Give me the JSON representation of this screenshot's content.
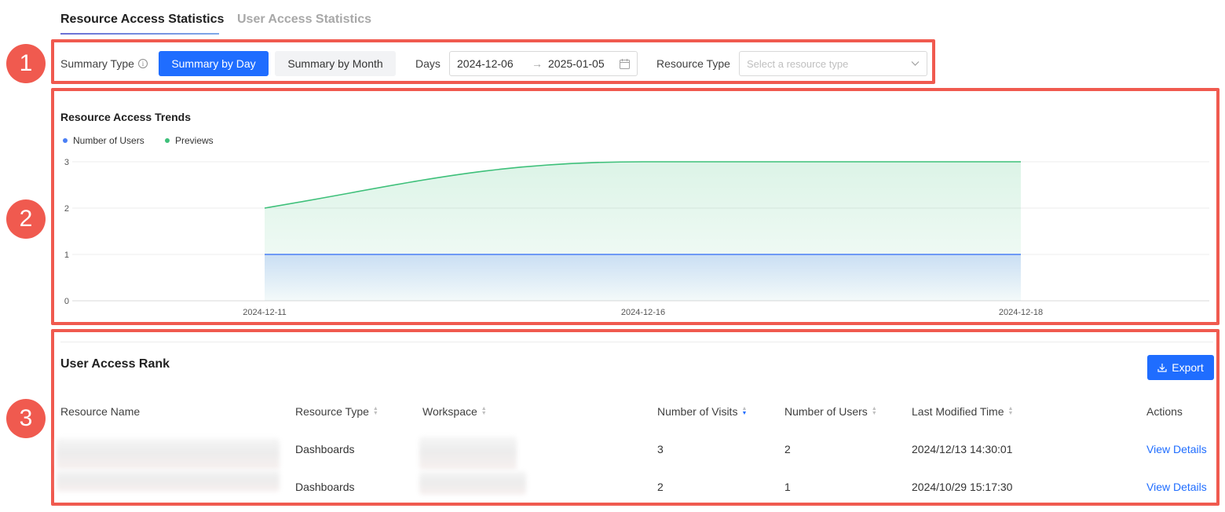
{
  "tabs": [
    {
      "label": "Resource Access Statistics",
      "active": true
    },
    {
      "label": "User Access Statistics",
      "active": false
    }
  ],
  "annotations": [
    "1",
    "2",
    "3"
  ],
  "filters": {
    "summary_type_label": "Summary Type",
    "summary_by_day": "Summary by Day",
    "summary_by_month": "Summary by Month",
    "days_label": "Days",
    "date_start": "2024-12-06",
    "date_separator": "→",
    "date_end": "2025-01-05",
    "resource_type_label": "Resource Type",
    "resource_type_placeholder": "Select a resource type"
  },
  "chart_data": {
    "type": "area",
    "title": "Resource Access Trends",
    "x": [
      "2024-12-11",
      "2024-12-16",
      "2024-12-18"
    ],
    "series": [
      {
        "name": "Number of Users",
        "values": [
          1,
          1,
          1
        ],
        "color": "#4a7ff5"
      },
      {
        "name": "Previews",
        "values": [
          2,
          3,
          3
        ],
        "color": "#3ec07a"
      }
    ],
    "ylim": [
      0,
      3
    ],
    "yticks": [
      0,
      1,
      2,
      3
    ],
    "legend_position": "top-left",
    "grid": true
  },
  "rank": {
    "title": "User Access Rank",
    "export_label": "Export",
    "columns": [
      "Resource Name",
      "Resource Type",
      "Workspace",
      "Number of Visits",
      "Number of Users",
      "Last Modified Time",
      "Actions"
    ],
    "rows": [
      {
        "resource_type": "Dashboards",
        "visits": "3",
        "users": "2",
        "modified": "2024/12/13 14:30:01",
        "action": "View Details"
      },
      {
        "resource_type": "Dashboards",
        "visits": "2",
        "users": "1",
        "modified": "2024/10/29 15:17:30",
        "action": "View Details"
      }
    ]
  },
  "colors": {
    "primary": "#1f6dff",
    "annotation": "#f05a4f",
    "users_series": "#4a7ff5",
    "previews_series": "#3ec07a"
  }
}
